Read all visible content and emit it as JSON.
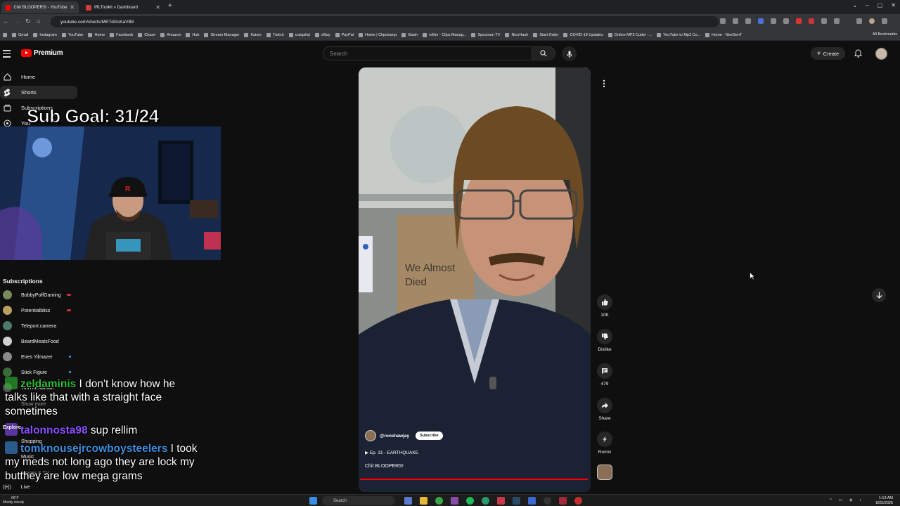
{
  "browser": {
    "tabs": [
      {
        "title": "Chit BLOOPERS! - YouTube",
        "active": true
      },
      {
        "title": "IRLToolkit » Dashboard",
        "active": false
      }
    ],
    "new_tab": "+",
    "url": "youtube.com/shorts/METdGsKaVB8",
    "bookmarks": [
      "Gmail",
      "Instagram",
      "YouTube",
      "Home",
      "Facebook",
      "Chase",
      "Amazon",
      "Hub",
      "Stream Manager",
      "Kaiser",
      "Twitch",
      "craigslist",
      "eBay",
      "PayPal",
      "Home | Clipchamp",
      "Stash",
      "rellim - Clips Manag...",
      "Spectrum TV",
      "NiceHash",
      "Start Order",
      "COVID-19 Updates",
      "Online MP3 Cutter -...",
      "YouTube to Mp3 Co...",
      "Home - NexGenT"
    ],
    "all_bookmarks": "All Bookmarks"
  },
  "yt": {
    "logo_text": "Premium",
    "search_placeholder": "Search",
    "create_label": "Create",
    "guide": [
      {
        "label": "Home",
        "icon": "home-icon"
      },
      {
        "label": "Shorts",
        "icon": "shorts-icon",
        "active": true
      },
      {
        "label": "Subscriptions",
        "icon": "subscriptions-icon"
      },
      {
        "label": "You",
        "icon": "you-icon"
      }
    ],
    "subscriptions_heading": "Subscriptions",
    "subscriptions": [
      {
        "name": "BobbyPoffGaming",
        "status": "live",
        "color": "#7a8a5a"
      },
      {
        "name": "Potentialbliss",
        "status": "live",
        "color": "#b8a060"
      },
      {
        "name": "Teleport.camera",
        "status": "none",
        "color": "#4a7a6a"
      },
      {
        "name": "BeardMeatsFood",
        "status": "none",
        "color": "#d0d0d0"
      },
      {
        "name": "Enes Yilmazer",
        "status": "new",
        "color": "#8a8a8a"
      },
      {
        "name": "Stick Figure",
        "status": "new",
        "color": "#3a6a3a"
      },
      {
        "name": "TimTheTatman",
        "status": "none",
        "color": "#555555"
      }
    ],
    "show_more": "Show more",
    "explore": "Explore",
    "explore_items": [
      "Shopping",
      "Music",
      "Movies & TV",
      "Live"
    ]
  },
  "overlay": {
    "sub_goal": "Sub Goal: 31/24",
    "chat": [
      {
        "user": "zeldaminis",
        "user_color": "#2ebd34",
        "message_line1": " I don't know how he",
        "message_rest": [
          "talks like that with a straight face",
          "sometimes"
        ]
      },
      {
        "user": "talonnosta98",
        "user_color": "#8a4fff",
        "message_line1": " sup rellim",
        "message_rest": []
      },
      {
        "user": "tomknousejrcowboysteelers",
        "user_color": "#3a8fe0",
        "message_line1": " I took",
        "message_rest": [
          "my meds not long ago they are lock my",
          "butthey are low mega grams"
        ]
      }
    ]
  },
  "short": {
    "channel": "@ronshawjay",
    "subscribe_label": "Subscribe",
    "playlist": "Ep. 31 - EARTHQUAKE",
    "title": "Chit BLOOPERS!",
    "progress": 1.0,
    "whiteboard_text": [
      "We Almost",
      "Died"
    ],
    "actions": [
      {
        "name": "like",
        "icon": "thumbs-up-icon",
        "label": "10K"
      },
      {
        "name": "dislike",
        "icon": "thumbs-down-icon",
        "label": "Dislike"
      },
      {
        "name": "comments",
        "icon": "comment-icon",
        "label": "479"
      },
      {
        "name": "share",
        "icon": "share-icon",
        "label": "Share"
      },
      {
        "name": "remix",
        "icon": "remix-icon",
        "label": "Remix"
      }
    ]
  },
  "taskbar": {
    "weather_temp": "66°F",
    "weather_desc": "Mostly cloudy",
    "search_placeholder": "Search",
    "time": "1:13 AM",
    "date": "8/22/2025"
  }
}
